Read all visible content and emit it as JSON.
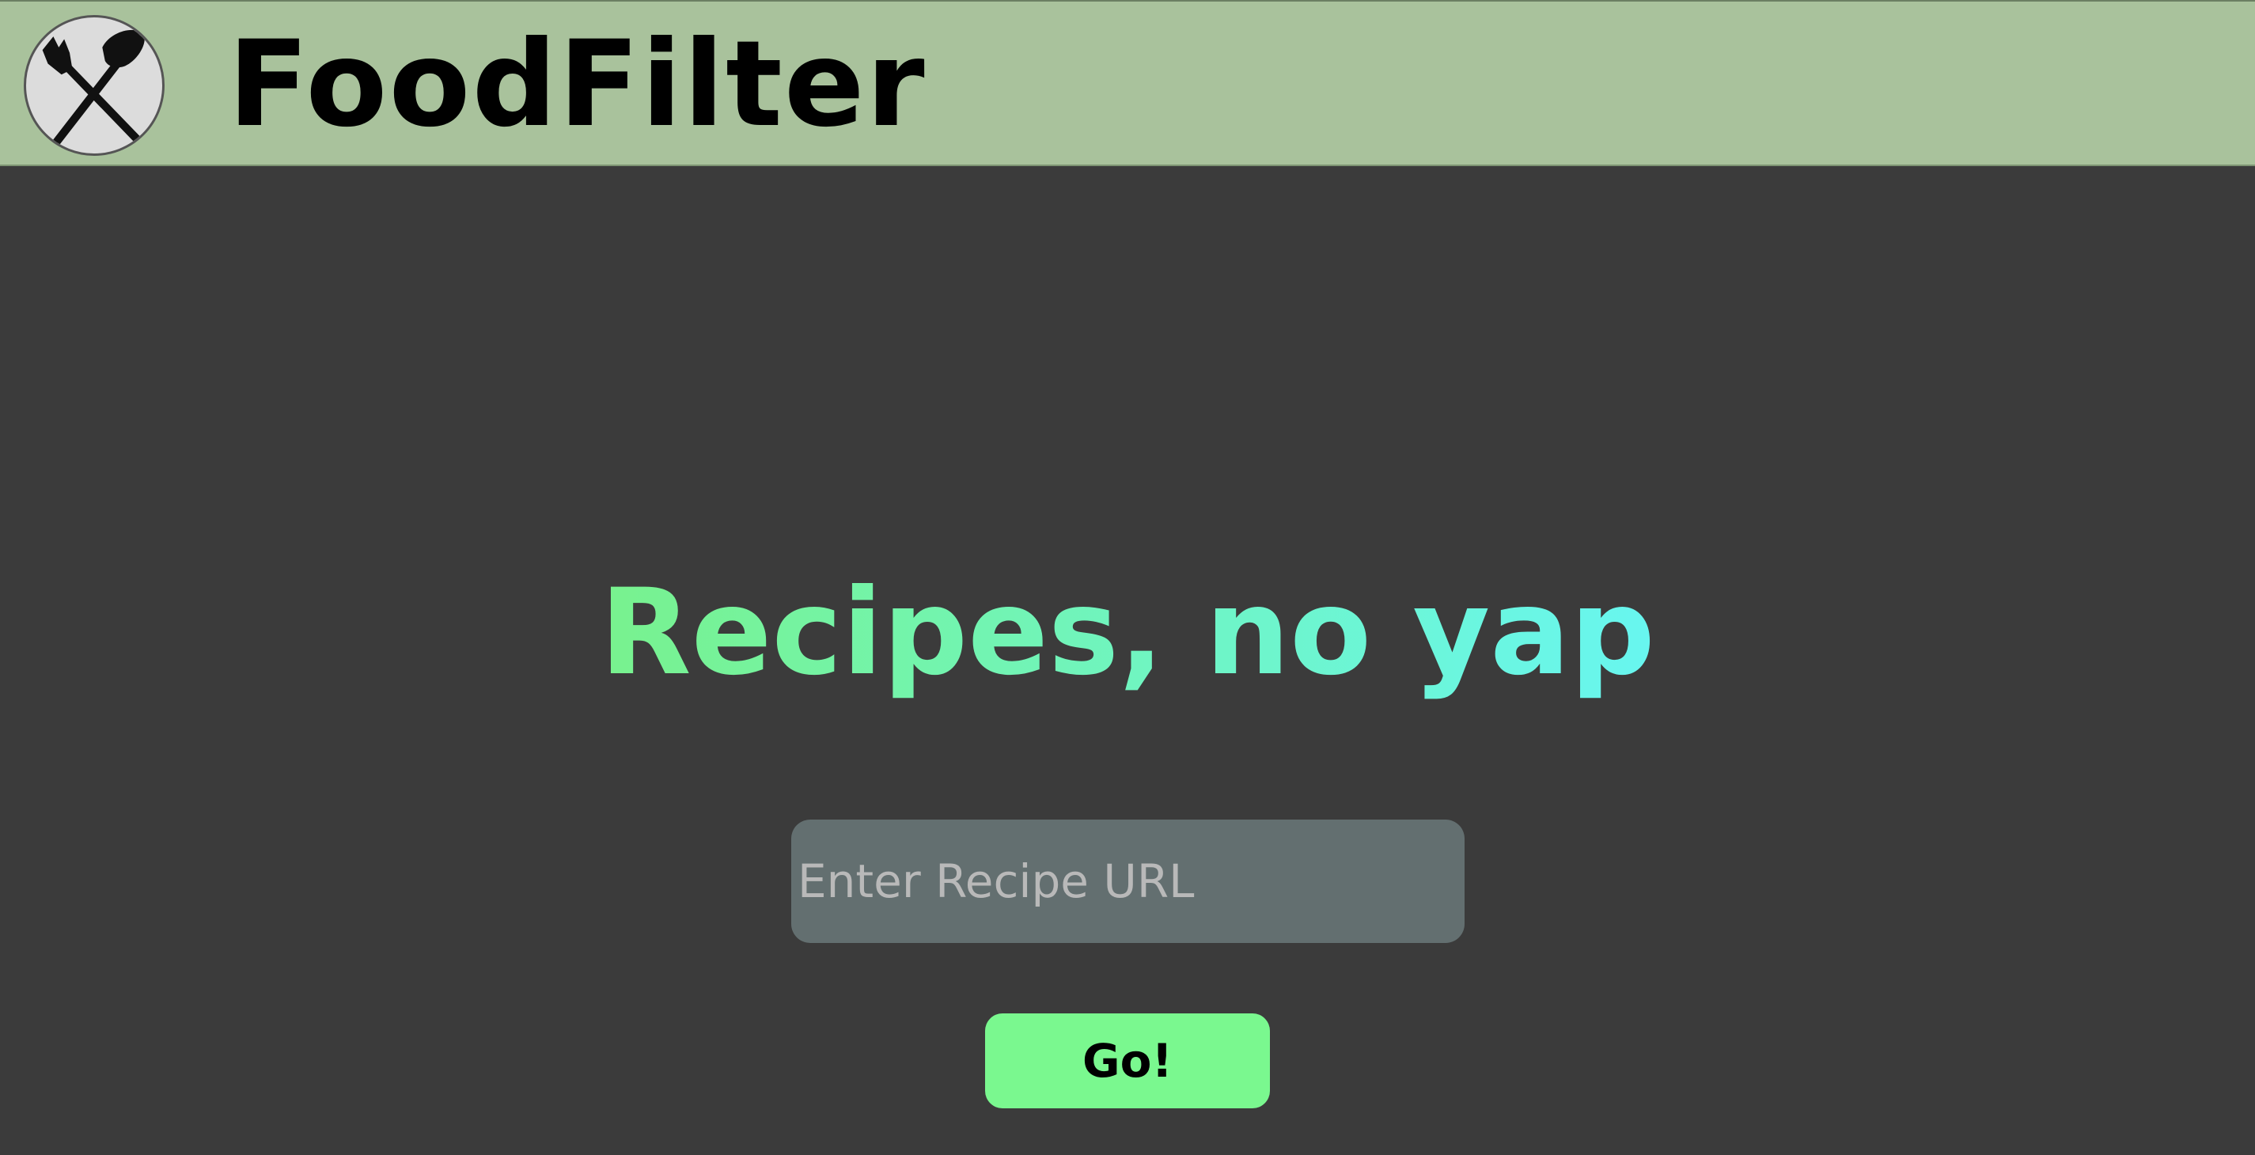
{
  "header": {
    "logo_icon": "fork-and-spatula-icon",
    "brand": "FoodFilter"
  },
  "hero": {
    "headline": "Recipes, no yap"
  },
  "search": {
    "placeholder": "Enter Recipe URL",
    "value": ""
  },
  "actions": {
    "go_label": "Go!"
  },
  "colors": {
    "header_bg": "#a9c29c",
    "page_bg": "#3b3b3b",
    "accent_green": "#7af88f",
    "accent_cyan": "#68f6f0",
    "input_bg": "#636f70"
  }
}
